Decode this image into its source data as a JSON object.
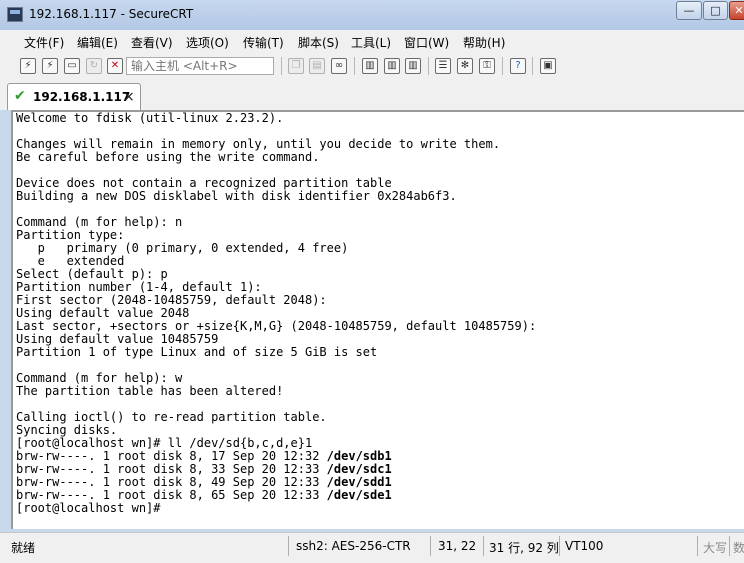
{
  "window": {
    "title": "192.168.1.117 - SecureCRT",
    "min_glyph": "—",
    "max_glyph": "□",
    "close_glyph": "✕"
  },
  "menu": [
    "文件(F)",
    "编辑(E)",
    "查看(V)",
    "选项(O)",
    "传输(T)",
    "脚本(S)",
    "工具(L)",
    "窗口(W)",
    "帮助(H)"
  ],
  "toolbar": {
    "host_placeholder": "输入主机 <Alt+R>",
    "icons": [
      "connect-icon",
      "quick-connect-icon",
      "connect-in-tab-icon",
      "reconnect-icon",
      "disconnect-icon",
      "copy-icon",
      "paste-icon",
      "find-icon",
      "print-icon",
      "print-selection-icon",
      "print-setup-icon",
      "session-options-icon",
      "global-options-icon",
      "keymap-icon",
      "help-icon",
      "sftp-icon"
    ]
  },
  "tab": {
    "label": "192.168.1.117",
    "check_glyph": "✔",
    "close_glyph": "×"
  },
  "terminal": {
    "lines": [
      "Welcome to fdisk (util-linux 2.23.2).",
      "",
      "Changes will remain in memory only, until you decide to write them.",
      "Be careful before using the write command.",
      "",
      "Device does not contain a recognized partition table",
      "Building a new DOS disklabel with disk identifier 0x284ab6f3.",
      "",
      "Command (m for help): n",
      "Partition type:",
      "   p   primary (0 primary, 0 extended, 4 free)",
      "   e   extended",
      "Select (default p): p",
      "Partition number (1-4, default 1):",
      "First sector (2048-10485759, default 2048):",
      "Using default value 2048",
      "Last sector, +sectors or +size{K,M,G} (2048-10485759, default 10485759):",
      "Using default value 10485759",
      "Partition 1 of type Linux and of size 5 GiB is set",
      "",
      "Command (m for help): w",
      "The partition table has been altered!",
      "",
      "Calling ioctl() to re-read partition table.",
      "Syncing disks.",
      "[root@localhost wn]# ll /dev/sd{b,c,d,e}1"
    ],
    "listing": [
      {
        "perm": "brw-rw----. 1 root disk 8, 17 Sep 20 12:32 ",
        "path": "/dev/sdb1"
      },
      {
        "perm": "brw-rw----. 1 root disk 8, 33 Sep 20 12:33 ",
        "path": "/dev/sdc1"
      },
      {
        "perm": "brw-rw----. 1 root disk 8, 49 Sep 20 12:33 ",
        "path": "/dev/sdd1"
      },
      {
        "perm": "brw-rw----. 1 root disk 8, 65 Sep 20 12:33 ",
        "path": "/dev/sde1"
      }
    ],
    "prompt": "[root@localhost wn]#"
  },
  "status": {
    "ready": "就绪",
    "cipher": "ssh2: AES-256-CTR",
    "cursor": "31,  22",
    "size": "31 行, 92 列",
    "term_type": "VT100",
    "caps": "大写",
    "num": "数"
  }
}
